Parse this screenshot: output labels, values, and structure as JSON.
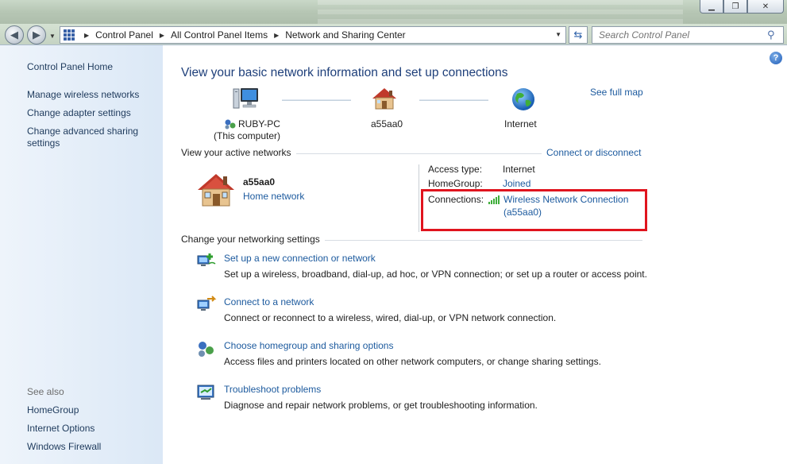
{
  "window": {
    "minimize_glyph": "▁",
    "maximize_glyph": "❐",
    "close_glyph": "✕"
  },
  "address_bar": {
    "breadcrumbs": [
      "Control Panel",
      "All Control Panel Items",
      "Network and Sharing Center"
    ],
    "search_placeholder": "Search Control Panel"
  },
  "sidebar": {
    "home": "Control Panel Home",
    "tasks": [
      "Manage wireless networks",
      "Change adapter settings",
      "Change advanced sharing settings"
    ],
    "see_also_label": "See also",
    "see_also": [
      "HomeGroup",
      "Internet Options",
      "Windows Firewall"
    ]
  },
  "main": {
    "title": "View your basic network information and set up connections",
    "see_full_map": "See full map",
    "map_nodes": [
      {
        "icon": "computer-icon",
        "label_line1": "RUBY-PC",
        "label_line2": "(This computer)"
      },
      {
        "icon": "house-icon",
        "label_line1": "a55aa0"
      },
      {
        "icon": "globe-icon",
        "label_line1": "Internet"
      }
    ],
    "active_networks_heading": "View your active networks",
    "connect_or_disconnect": "Connect or disconnect",
    "active_network": {
      "name": "a55aa0",
      "type_link": "Home network",
      "access_type_label": "Access type:",
      "access_type_value": "Internet",
      "homegroup_label": "HomeGroup:",
      "homegroup_value": "Joined",
      "connections_label": "Connections:",
      "connection_name": "Wireless Network Connection",
      "connection_ssid": "(a55aa0)"
    },
    "settings_heading": "Change your networking settings",
    "tasks": [
      {
        "title": "Set up a new connection or network",
        "desc": "Set up a wireless, broadband, dial-up, ad hoc, or VPN connection; or set up a router or access point."
      },
      {
        "title": "Connect to a network",
        "desc": "Connect or reconnect to a wireless, wired, dial-up, or VPN network connection."
      },
      {
        "title": "Choose homegroup and sharing options",
        "desc": "Access files and printers located on other network computers, or change sharing settings."
      },
      {
        "title": "Troubleshoot problems",
        "desc": "Diagnose and repair network problems, or get troubleshooting information."
      }
    ]
  },
  "colors": {
    "link": "#1c5a9e",
    "title": "#1e3f7a",
    "highlight_box": "#e0141e",
    "sidebar_bg": "#dbe8f6"
  }
}
